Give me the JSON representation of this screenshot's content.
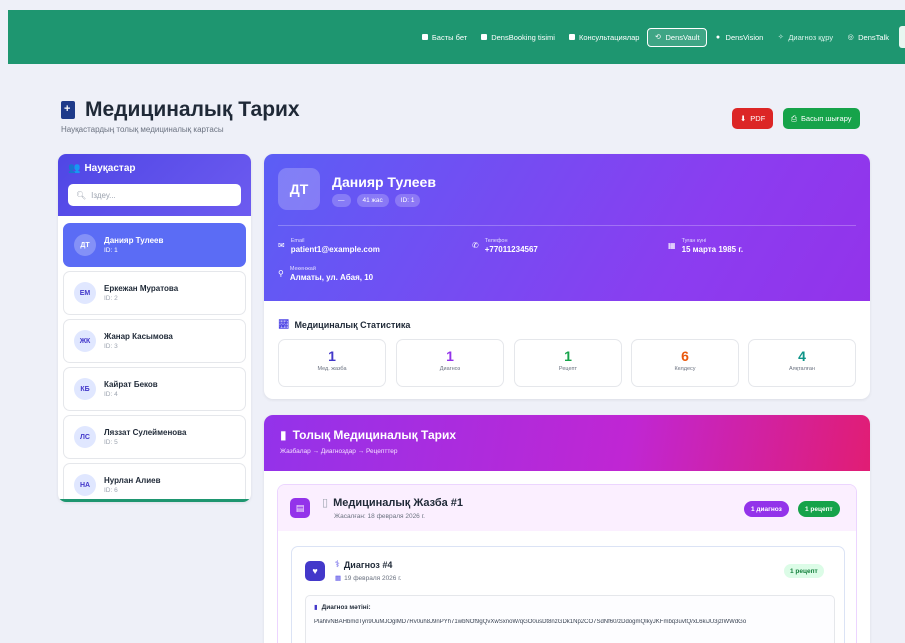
{
  "nav": {
    "items": [
      {
        "label": "Басты бет",
        "icon": "square-icon"
      },
      {
        "label": "DensBooking tisimi",
        "icon": "square-icon"
      },
      {
        "label": "Консультациялар",
        "icon": "square-icon"
      },
      {
        "label": "DensVault",
        "icon": "vault-icon",
        "active": true
      },
      {
        "label": "DensVision",
        "icon": "eye-icon"
      },
      {
        "label": "Диагноз құру",
        "icon": "magic-icon"
      },
      {
        "label": "DensTalk",
        "icon": "chat-icon"
      }
    ]
  },
  "header": {
    "title": "Медициналық Тарих",
    "subtitle": "Науқастардың толық медициналық картасы",
    "pdf_label": "PDF",
    "print_label": "Басып шығару"
  },
  "sidebar": {
    "title": "Науқастар",
    "search_placeholder": "Іздеу...",
    "patients": [
      {
        "initials": "ДТ",
        "name": "Данияр Тулеев",
        "id": "ID: 1",
        "selected": true
      },
      {
        "initials": "ЕМ",
        "name": "Еркежан Муратова",
        "id": "ID: 2"
      },
      {
        "initials": "ЖК",
        "name": "Жанар Касымова",
        "id": "ID: 3"
      },
      {
        "initials": "КБ",
        "name": "Кайрат Беков",
        "id": "ID: 4"
      },
      {
        "initials": "ЛС",
        "name": "Ляззат Сулейменова",
        "id": "ID: 5"
      },
      {
        "initials": "НА",
        "name": "Нурлан Алиев",
        "id": "ID: 6"
      }
    ]
  },
  "patient": {
    "initials": "ДТ",
    "name": "Данияр Тулеев",
    "badges": [
      "—",
      "41 жас",
      "ID: 1"
    ],
    "email_label": "Email",
    "email": "patient1@example.com",
    "phone_label": "Телефон",
    "phone": "+77011234567",
    "birth_label": "Туған күні",
    "birth": "15 марта 1985 г.",
    "address_label": "Мекенжай",
    "address": "Алматы, ул. Абая, 10"
  },
  "stats": {
    "title": "Медициналық Статистика",
    "items": [
      {
        "value": "1",
        "label": "Мед. жазба",
        "color": "#4338ca"
      },
      {
        "value": "1",
        "label": "Диагноз",
        "color": "#9333ea"
      },
      {
        "value": "1",
        "label": "Рецепт",
        "color": "#16a34a"
      },
      {
        "value": "6",
        "label": "Келдесу",
        "color": "#ea580c"
      },
      {
        "value": "4",
        "label": "Аяқталған",
        "color": "#0d9488"
      }
    ]
  },
  "history": {
    "title": "Толық Медициналық Тарих",
    "subtitle": "Жазбалар → Диагноздар → Рецепттер",
    "record": {
      "title": "Медициналық Жазба #1",
      "date": "Жасалған: 18 февраля 2026 г.",
      "diag_count": "1 диагноз",
      "rx_count": "1 рецепт"
    },
    "diagnosis": {
      "title": "Диагноз #4",
      "date": "19 февраля 2026 г.",
      "rx": "1 рецепт",
      "text_label": "Диагноз мәтіні:",
      "text": "PlahlvNBAHbmdTyn9UuMJOglMD7Rv0uh8J9nPYh71wbNOf9gQvXwSxnoW/qGO0usDt8nzGDk1Np2CO7SdNf60/zDdogmQIkyJKFmbq3uvtQ/xL6kiJU3jzIWWdGo"
    }
  }
}
